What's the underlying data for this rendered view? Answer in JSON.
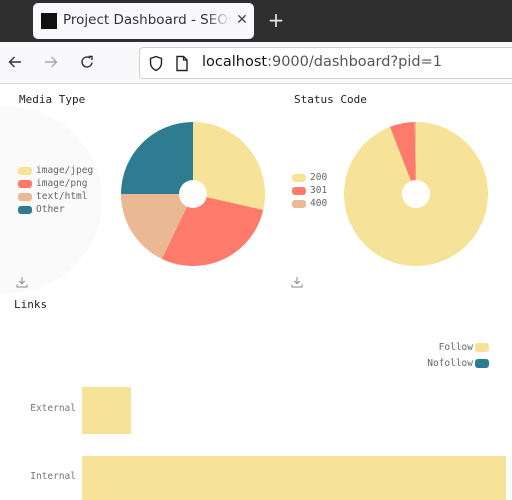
{
  "browser": {
    "tab_title": "Project Dashboard - SEOnaut",
    "tab_close_icon": "close-icon",
    "new_tab_icon": "plus-icon",
    "url_host": "localhost",
    "url_rest": ":9000/dashboard?pid=1"
  },
  "colors": {
    "yellow": "#f7e397",
    "coral": "#fe7a6a",
    "peach": "#eab893",
    "teal": "#2d7c91"
  },
  "chart_data": [
    {
      "type": "pie",
      "title": "Media Type",
      "donut": true,
      "legend_position": "left",
      "categories": [
        "image/jpeg",
        "image/png",
        "text/html",
        "Other"
      ],
      "values": [
        8,
        8,
        5,
        7
      ],
      "colors": [
        "#f7e397",
        "#fe7a6a",
        "#eab893",
        "#2d7c91"
      ],
      "download_icon": "download-icon"
    },
    {
      "type": "pie",
      "title": "Status Code",
      "donut": true,
      "legend_position": "left",
      "categories": [
        "200",
        "301",
        "400"
      ],
      "values": [
        320,
        19,
        1
      ],
      "colors": [
        "#f7e397",
        "#fe7a6a",
        "#eab893"
      ],
      "download_icon": "download-icon"
    },
    {
      "type": "bar",
      "orientation": "horizontal",
      "stacked": true,
      "title": "Links",
      "legend_position": "top-right",
      "categories": [
        "External",
        "Internal"
      ],
      "series": [
        {
          "name": "Follow",
          "color": "#f7e397",
          "values": [
            37,
            320
          ]
        },
        {
          "name": "Nofollow",
          "color": "#2d7c91",
          "values": [
            0,
            0
          ]
        }
      ],
      "xlim": [
        0,
        320
      ],
      "grid": false
    }
  ]
}
